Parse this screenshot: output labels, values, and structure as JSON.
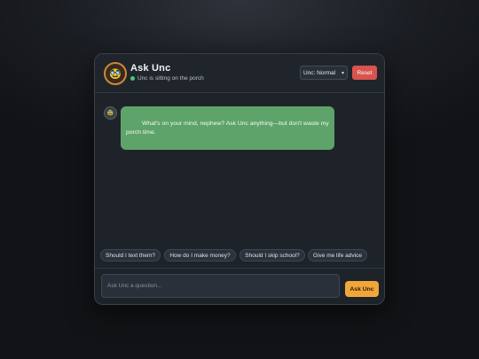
{
  "header": {
    "avatar_icon": "🥸",
    "title": "Ask Unc",
    "status_text": "Unc is sitting on the porch",
    "mode_select": {
      "value": "Unc: Normal"
    },
    "reset_label": "Reset"
  },
  "messages": [
    {
      "sender": "unc",
      "avatar_icon": "🥸",
      "text": "What's on your mind, nephew? Ask Unc anything—but don't waste my porch time."
    }
  ],
  "suggestions": [
    "Should I text them?",
    "How do I make money?",
    "Should I skip school?",
    "Give me life advice"
  ],
  "composer": {
    "placeholder": "Ask Unc a question...",
    "value": "",
    "send_label": "Ask Unc"
  },
  "colors": {
    "accent": "#f2a63a",
    "reset": "#d9534f",
    "bubble": "#5ea36a",
    "status_online": "#48c774"
  }
}
